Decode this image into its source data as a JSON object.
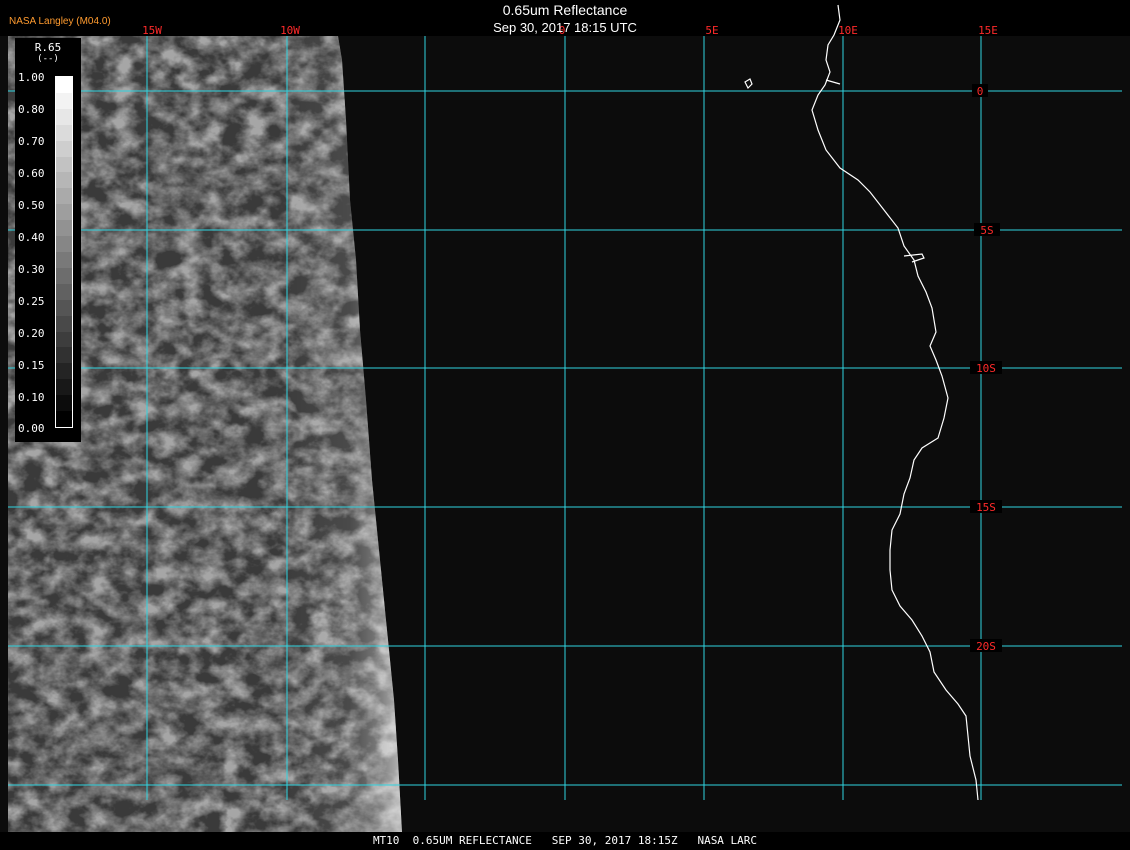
{
  "credit": "NASA Langley (M04.0)",
  "title": "0.65um Reflectance",
  "subtitle": "Sep 30, 2017 18:15 UTC",
  "footer": "MT10  0.65UM REFLECTANCE   SEP 30, 2017 18:15Z   NASA LARC",
  "grid": {
    "lon_labels": [
      "15W",
      "10W",
      "0",
      "5E",
      "10E",
      "15E"
    ],
    "lat_labels": [
      "0",
      "5S",
      "10S",
      "15S",
      "20S"
    ],
    "line_color": "#2fd4e0",
    "label_color": "#ff2a2a"
  },
  "legend": {
    "title": "R.65",
    "unit": "(--)",
    "values": [
      "1.00",
      "0.80",
      "0.70",
      "0.60",
      "0.50",
      "0.40",
      "0.30",
      "0.25",
      "0.20",
      "0.15",
      "0.10",
      "0.00"
    ]
  },
  "colors": {
    "background": "#000000",
    "coastline": "#ffffff",
    "legend_text": "#ffffff",
    "credit": "#ff9b2f"
  }
}
